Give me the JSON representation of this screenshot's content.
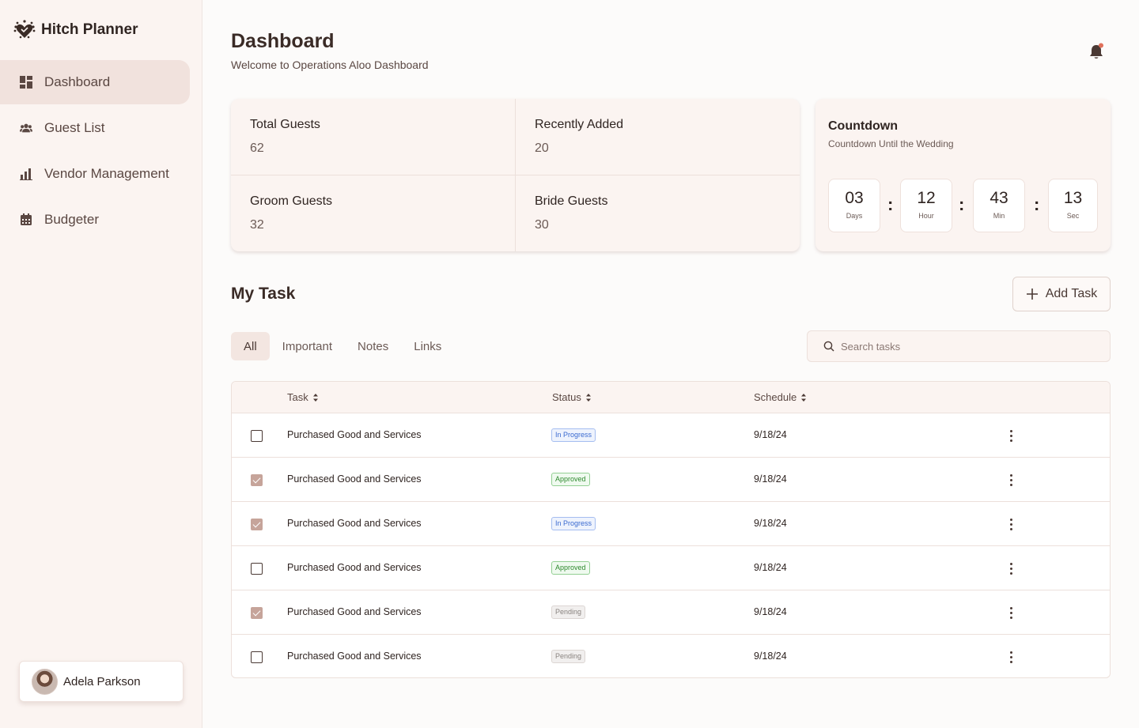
{
  "app": {
    "name": "Hitch Planner"
  },
  "sidebar": {
    "items": [
      {
        "label": "Dashboard",
        "icon": "dashboard-icon",
        "active": true
      },
      {
        "label": "Guest List",
        "icon": "guests-icon",
        "active": false
      },
      {
        "label": "Vendor Management",
        "icon": "bar-chart-icon",
        "active": false
      },
      {
        "label": "Budgeter",
        "icon": "calendar-icon",
        "active": false
      }
    ],
    "user": {
      "name": "Adela Parkson"
    }
  },
  "header": {
    "title": "Dashboard",
    "subtitle": "Welcome to Operations Aloo Dashboard"
  },
  "stats": [
    {
      "label": "Total Guests",
      "value": "62"
    },
    {
      "label": "Recently Added",
      "value": "20"
    },
    {
      "label": "Groom Guests",
      "value": "32"
    },
    {
      "label": "Bride Guests",
      "value": "30"
    }
  ],
  "countdown": {
    "title": "Countdown",
    "subtitle": "Countdown Until the Wedding",
    "units": [
      {
        "value": "03",
        "label": "Days"
      },
      {
        "value": "12",
        "label": "Hour"
      },
      {
        "value": "43",
        "label": "Min"
      },
      {
        "value": "13",
        "label": "Sec"
      }
    ],
    "separator": ":"
  },
  "tasks": {
    "title": "My Task",
    "add_label": "Add Task",
    "tabs": [
      {
        "label": "All",
        "active": true
      },
      {
        "label": "Important",
        "active": false
      },
      {
        "label": "Notes",
        "active": false
      },
      {
        "label": "Links",
        "active": false
      }
    ],
    "search_placeholder": "Search tasks",
    "columns": {
      "task": "Task",
      "status": "Status",
      "schedule": "Schedule"
    },
    "rows": [
      {
        "checked": false,
        "task": "Purchased Good and Services",
        "status": "In Progress",
        "status_key": "in-progress",
        "schedule": "9/18/24"
      },
      {
        "checked": true,
        "task": "Purchased Good and Services",
        "status": "Approved",
        "status_key": "approved",
        "schedule": "9/18/24"
      },
      {
        "checked": true,
        "task": "Purchased Good and Services",
        "status": "In Progress",
        "status_key": "in-progress",
        "schedule": "9/18/24"
      },
      {
        "checked": false,
        "task": "Purchased Good and Services",
        "status": "Approved",
        "status_key": "approved",
        "schedule": "9/18/24"
      },
      {
        "checked": true,
        "task": "Purchased Good and Services",
        "status": "Pending",
        "status_key": "pending",
        "schedule": "9/18/24"
      },
      {
        "checked": false,
        "task": "Purchased Good and Services",
        "status": "Pending",
        "status_key": "pending",
        "schedule": "9/18/24"
      }
    ]
  },
  "colors": {
    "sidebar_bg": "#fbf4f1",
    "active_nav": "#f1e2dd",
    "checkbox_checked": "#c6a49a",
    "in_progress": "#3a6ad0",
    "approved": "#2f8a2f",
    "pending": "#8a8480"
  }
}
